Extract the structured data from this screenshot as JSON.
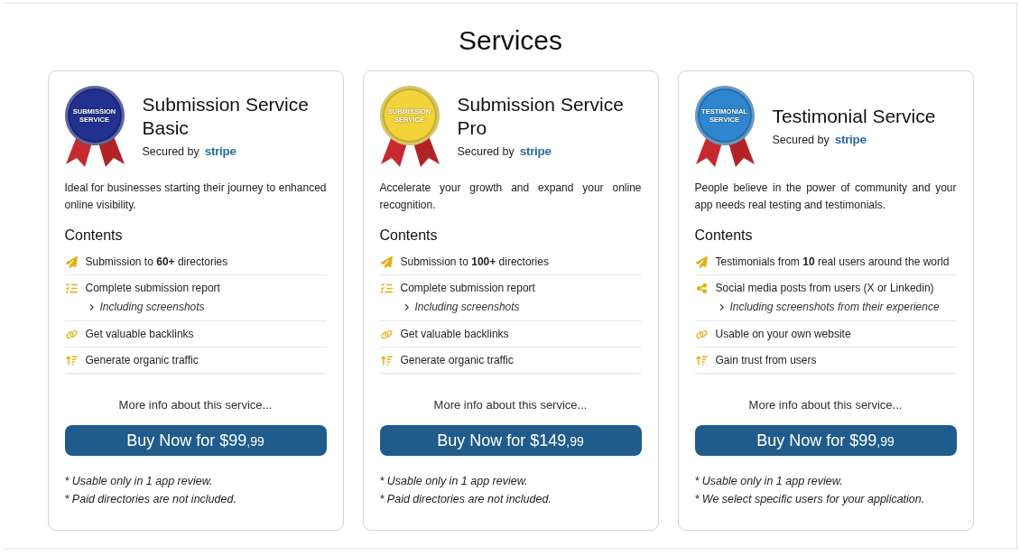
{
  "page": {
    "title": "Services"
  },
  "services": [
    {
      "title": "Submission Service Basic",
      "secured_label": "Secured by",
      "secured_logo": "stripe",
      "badge": {
        "lines": [
          "SUBMISSION",
          "SERVICE"
        ],
        "color": "#22308f"
      },
      "description": "Ideal for businesses starting their journey to enhanced online visibility.",
      "contents_heading": "Contents",
      "features": [
        {
          "kind": "send",
          "text": "Submission to **60+** directories"
        },
        {
          "kind": "checklist",
          "text": "Complete submission report",
          "sub": "Including screenshots"
        },
        {
          "kind": "link",
          "text": "Get valuable backlinks"
        },
        {
          "kind": "growth",
          "text": "Generate organic traffic"
        }
      ],
      "more_info": "More info about this service...",
      "buy": {
        "label": "Buy Now for $99",
        "cents": ",99"
      },
      "notes": [
        "* Usable only in 1 app review.",
        "* Paid directories are not included."
      ]
    },
    {
      "title": "Submission Service Pro",
      "secured_label": "Secured by",
      "secured_logo": "stripe",
      "badge": {
        "lines": [
          "SUBMISSION",
          "SERVICE"
        ],
        "color": "#f2d43a"
      },
      "description": "Accelerate your growth and expand your online recognition.",
      "contents_heading": "Contents",
      "features": [
        {
          "kind": "send",
          "text": "Submission to **100+** directories"
        },
        {
          "kind": "checklist",
          "text": "Complete submission report",
          "sub": "Including screenshots"
        },
        {
          "kind": "link",
          "text": "Get valuable backlinks"
        },
        {
          "kind": "growth",
          "text": "Generate organic traffic"
        }
      ],
      "more_info": "More info about this service...",
      "buy": {
        "label": "Buy Now for $149",
        "cents": ",99"
      },
      "notes": [
        "* Usable only in 1 app review.",
        "* Paid directories are not included."
      ]
    },
    {
      "title": "Testimonial Service",
      "secured_label": "Secured by",
      "secured_logo": "stripe",
      "badge": {
        "lines": [
          "TESTIMONIAL",
          "SERVICE"
        ],
        "color": "#2f86cf"
      },
      "description": "People believe in the power of community and your app needs real testing and testimonials.",
      "contents_heading": "Contents",
      "features": [
        {
          "kind": "send",
          "text": "Testimonials from **10** real users around the world"
        },
        {
          "kind": "share",
          "text": "Social media posts from users (X or Linkedin)",
          "sub": "Including screenshots from their experience"
        },
        {
          "kind": "link",
          "text": "Usable on your own website"
        },
        {
          "kind": "growth",
          "text": "Gain trust from users"
        }
      ],
      "more_info": "More info about this service...",
      "buy": {
        "label": "Buy Now for $99",
        "cents": ",99"
      },
      "notes": [
        "* Usable only in 1 app review.",
        "* We select specific users for your application."
      ]
    }
  ]
}
